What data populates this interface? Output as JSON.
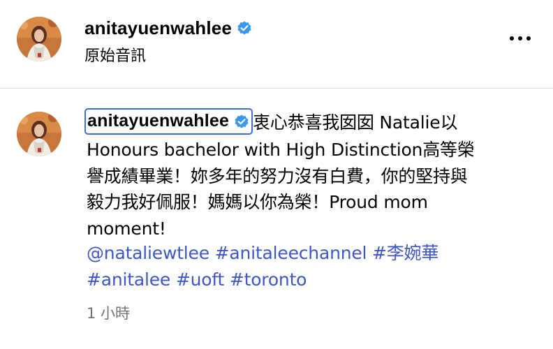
{
  "header": {
    "username": "anitayuenwahlee",
    "audio_label": "原始音訊",
    "more_label": "..."
  },
  "post": {
    "username": "anitayuenwahlee",
    "caption_line1": "衷心恭喜我囡囡 Natalie以",
    "caption_line2": "Honours bachelor with High Distinction高等榮",
    "caption_line3": "譽成績畢業！妳多年的努力沒有白費，你的堅持與",
    "caption_line4": "毅力我好佩服！媽媽以你為榮！Proud mom",
    "caption_line5": "moment!",
    "tags": [
      "@nataliewtlee",
      "#anitaleechannel",
      "#李婉華",
      "#anitalee",
      "#uoft",
      "#toronto"
    ],
    "timestamp": "1 小時"
  },
  "colors": {
    "verified_badge": "#3897f0",
    "link": "#3d56c8",
    "focus_ring": "#3b6fd8",
    "timestamp": "#737373",
    "divider": "#dbdbdb"
  },
  "icons": {
    "verified": "verified-badge-icon",
    "more": "more-options-icon"
  }
}
